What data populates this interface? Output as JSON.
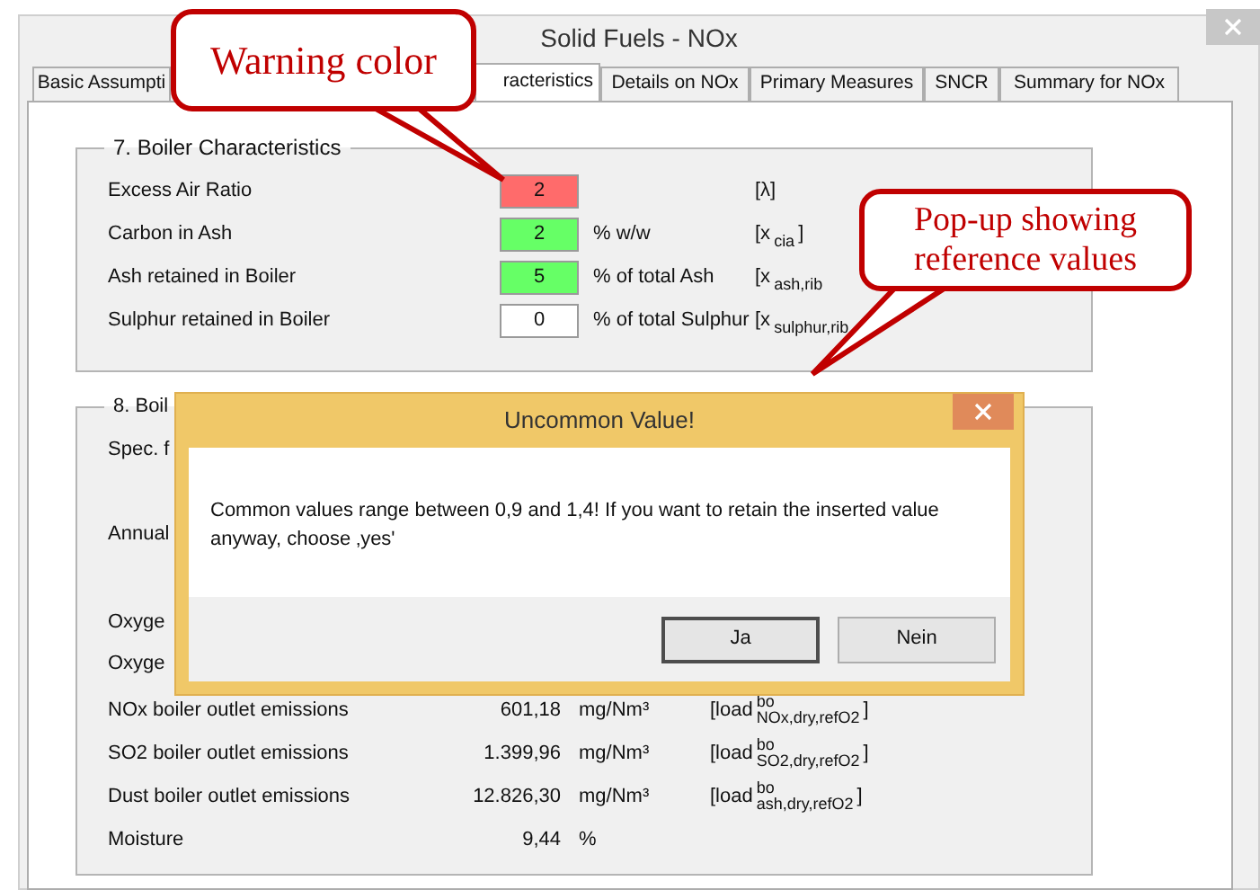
{
  "window": {
    "title": "Solid Fuels - NOx"
  },
  "tabs": [
    {
      "label": "Basic Assumpti",
      "selected": false
    },
    {
      "label": "racteristics",
      "selected": true
    },
    {
      "label": "Details on NOx",
      "selected": false
    },
    {
      "label": "Primary Measures",
      "selected": false
    },
    {
      "label": "SNCR",
      "selected": false
    },
    {
      "label": "Summary for NOx",
      "selected": false
    }
  ],
  "boiler_characteristics": {
    "title": "7. Boiler Characteristics",
    "rows": [
      {
        "label": "Excess Air Ratio",
        "value": "2",
        "color": "#ff6b6b",
        "symbol": "[λ]"
      },
      {
        "label": "Carbon in Ash",
        "value": "2",
        "color": "#66ff66",
        "unit": "% w/w",
        "symbol_prefix": "[x",
        "symbol_sub": "cia",
        "symbol_suffix": "]"
      },
      {
        "label": "Ash retained in Boiler",
        "value": "5",
        "color": "#66ff66",
        "unit": "% of total Ash",
        "symbol_prefix": "[x",
        "symbol_sub": "ash,rib"
      },
      {
        "label": "Sulphur retained in Boiler",
        "value": "0",
        "color": "#ffffff",
        "unit": "% of total Sulphur",
        "symbol_prefix": "[x",
        "symbol_sub": "sulphur,rib"
      }
    ]
  },
  "boiler_section": {
    "title": "8. Boil",
    "partial_labels": [
      "Spec. f",
      "Annual",
      "Oxyge",
      "Oxyge"
    ],
    "rows": [
      {
        "label": "NOx boiler outlet emissions",
        "value": "601,18",
        "unit": "mg/Nm³",
        "symbol_prefix": "[load",
        "symbol_sup": "bo",
        "symbol_sub": "NOx,dry,refO2",
        "symbol_suffix": "]"
      },
      {
        "label": "SO2 boiler outlet emissions",
        "value": "1.399,96",
        "unit": "mg/Nm³",
        "symbol_prefix": "[load",
        "symbol_sup": "bo",
        "symbol_sub": "SO2,dry,refO2",
        "symbol_suffix": "]"
      },
      {
        "label": "Dust boiler outlet emissions",
        "value": "12.826,30",
        "unit": "mg/Nm³",
        "symbol_prefix": "[load",
        "symbol_sup": "bo",
        "symbol_sub": "ash,dry,refO2",
        "symbol_suffix": "]"
      },
      {
        "label": "Moisture",
        "value": "9,44",
        "unit": "%"
      }
    ]
  },
  "dialog": {
    "title": "Uncommon Value!",
    "message": "Common values range between 0,9 and 1,4! If you want to retain the inserted value anyway, choose ‚yes'",
    "buttons": [
      "Ja",
      "Nein"
    ]
  },
  "callouts": [
    {
      "text": "Warning color"
    },
    {
      "text": "Pop-up showing reference values"
    }
  ]
}
